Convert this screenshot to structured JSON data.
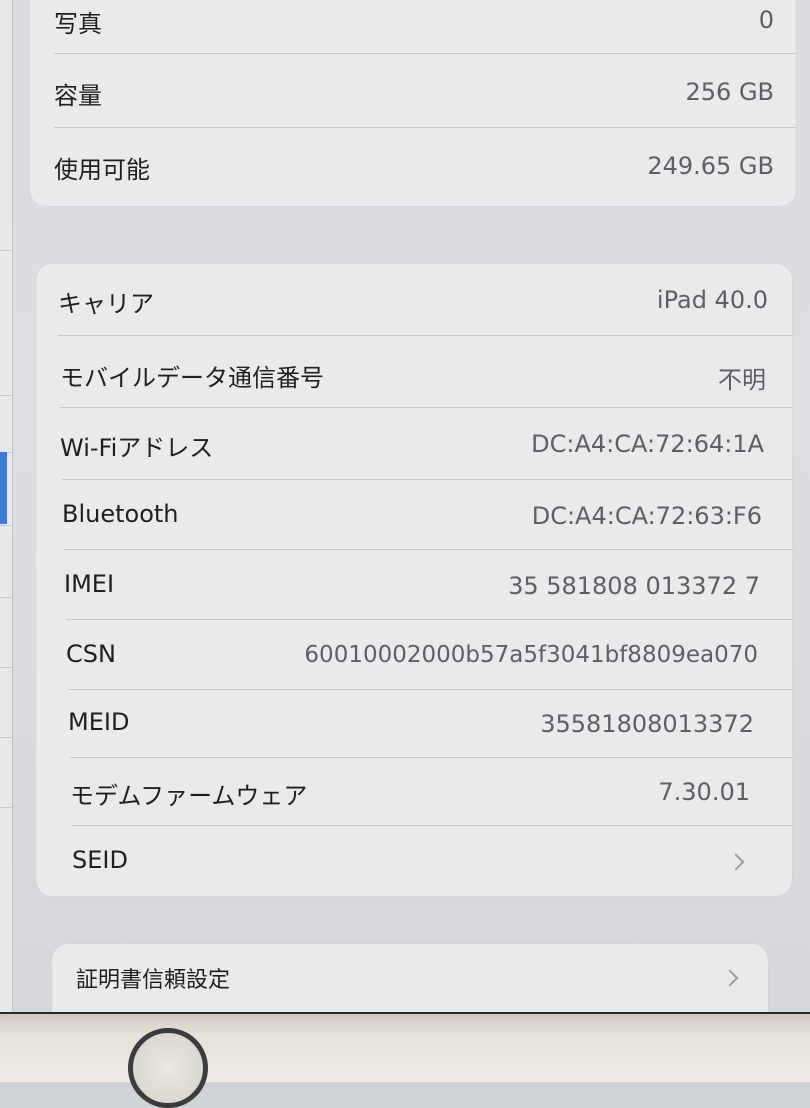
{
  "storage_group": {
    "rows": [
      {
        "label": "写真",
        "value": "0"
      },
      {
        "label": "容量",
        "value": "256 GB"
      },
      {
        "label": "使用可能",
        "value": "249.65 GB"
      }
    ]
  },
  "network_group": {
    "rows": [
      {
        "label": "キャリア",
        "value": "iPad 40.0"
      },
      {
        "label": "モバイルデータ通信番号",
        "value": "不明"
      },
      {
        "label": "Wi-Fiアドレス",
        "value": "DC:A4:CA:72:64:1A"
      },
      {
        "label": "Bluetooth",
        "value": "DC:A4:CA:72:63:F6"
      },
      {
        "label": "IMEI",
        "value": "35 581808 013372 7"
      },
      {
        "label": "CSN",
        "value": "60010002000b57a5f3041bf8809ea070"
      },
      {
        "label": "MEID",
        "value": "35581808013372"
      },
      {
        "label": "モデムファームウェア",
        "value": "7.30.01"
      },
      {
        "label": "SEID",
        "value": ""
      }
    ]
  },
  "cert_group": {
    "label": "証明書信頼設定"
  },
  "icons": {
    "chevron": "chevron-right-icon",
    "home": "home-button"
  }
}
